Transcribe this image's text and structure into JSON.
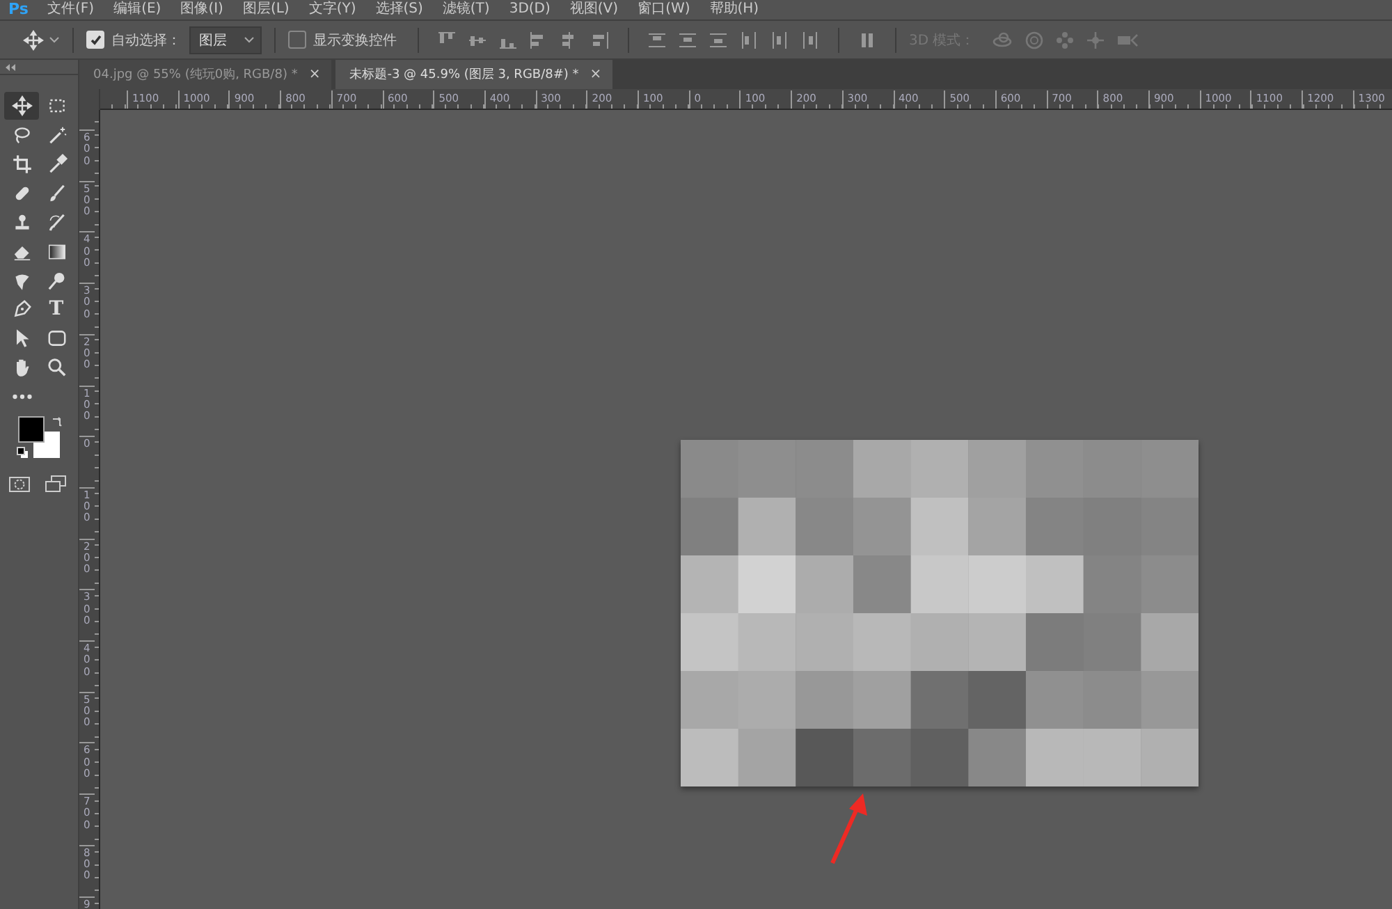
{
  "menu_bar": {
    "logo": "Ps",
    "items": [
      "文件(F)",
      "编辑(E)",
      "图像(I)",
      "图层(L)",
      "文字(Y)",
      "选择(S)",
      "滤镜(T)",
      "3D(D)",
      "视图(V)",
      "窗口(W)",
      "帮助(H)"
    ]
  },
  "options_bar": {
    "auto_select": {
      "label": "自动选择：",
      "checked": true
    },
    "auto_select_target": {
      "value": "图层"
    },
    "show_transform": {
      "label": "显示变换控件",
      "checked": false
    },
    "mode_3d_label": "3D 模式："
  },
  "tabs": [
    {
      "label": "04.jpg @ 55% (纯玩0购, RGB/8) *",
      "close": "×",
      "selected": false
    },
    {
      "label": "未标题-3 @ 45.9% (图层 3, RGB/8#) *",
      "close": "×",
      "selected": true
    }
  ],
  "rulers": {
    "horizontal": [
      "1100",
      "1000",
      "900",
      "800",
      "700",
      "600",
      "500",
      "400",
      "300",
      "200",
      "100",
      "0",
      "100",
      "200",
      "300",
      "400",
      "500",
      "600",
      "700",
      "800",
      "900",
      "1000",
      "1100",
      "1200",
      "1300"
    ],
    "vertical": [
      "600",
      "500",
      "400",
      "300",
      "200",
      "100",
      "0",
      "100",
      "200",
      "300",
      "400",
      "500",
      "600",
      "700",
      "800",
      "9"
    ]
  },
  "toolbar": {
    "tools": [
      {
        "kind": "move",
        "selected": true
      },
      {
        "kind": "marquee",
        "selected": false
      },
      {
        "kind": "lasso",
        "selected": false
      },
      {
        "kind": "wand",
        "selected": false
      },
      {
        "kind": "crop",
        "selected": false
      },
      {
        "kind": "eyedropper",
        "selected": false
      },
      {
        "kind": "bandage",
        "selected": false
      },
      {
        "kind": "brush",
        "selected": false
      },
      {
        "kind": "stamp",
        "selected": false
      },
      {
        "kind": "history",
        "selected": false
      },
      {
        "kind": "eraser",
        "selected": false
      },
      {
        "kind": "gradient",
        "selected": false
      },
      {
        "kind": "smudge",
        "selected": false
      },
      {
        "kind": "dodge",
        "selected": false
      },
      {
        "kind": "pen",
        "selected": false
      },
      {
        "kind": "type",
        "glyph": "T",
        "selected": false
      },
      {
        "kind": "pointer",
        "selected": false
      },
      {
        "kind": "rectangle",
        "selected": false
      },
      {
        "kind": "hand",
        "selected": false
      },
      {
        "kind": "zoom",
        "selected": false
      },
      {
        "kind": "more",
        "selected": false
      }
    ],
    "swatches": [
      {
        "color": "#000000"
      },
      {
        "color": "#ffffff"
      }
    ]
  }
}
